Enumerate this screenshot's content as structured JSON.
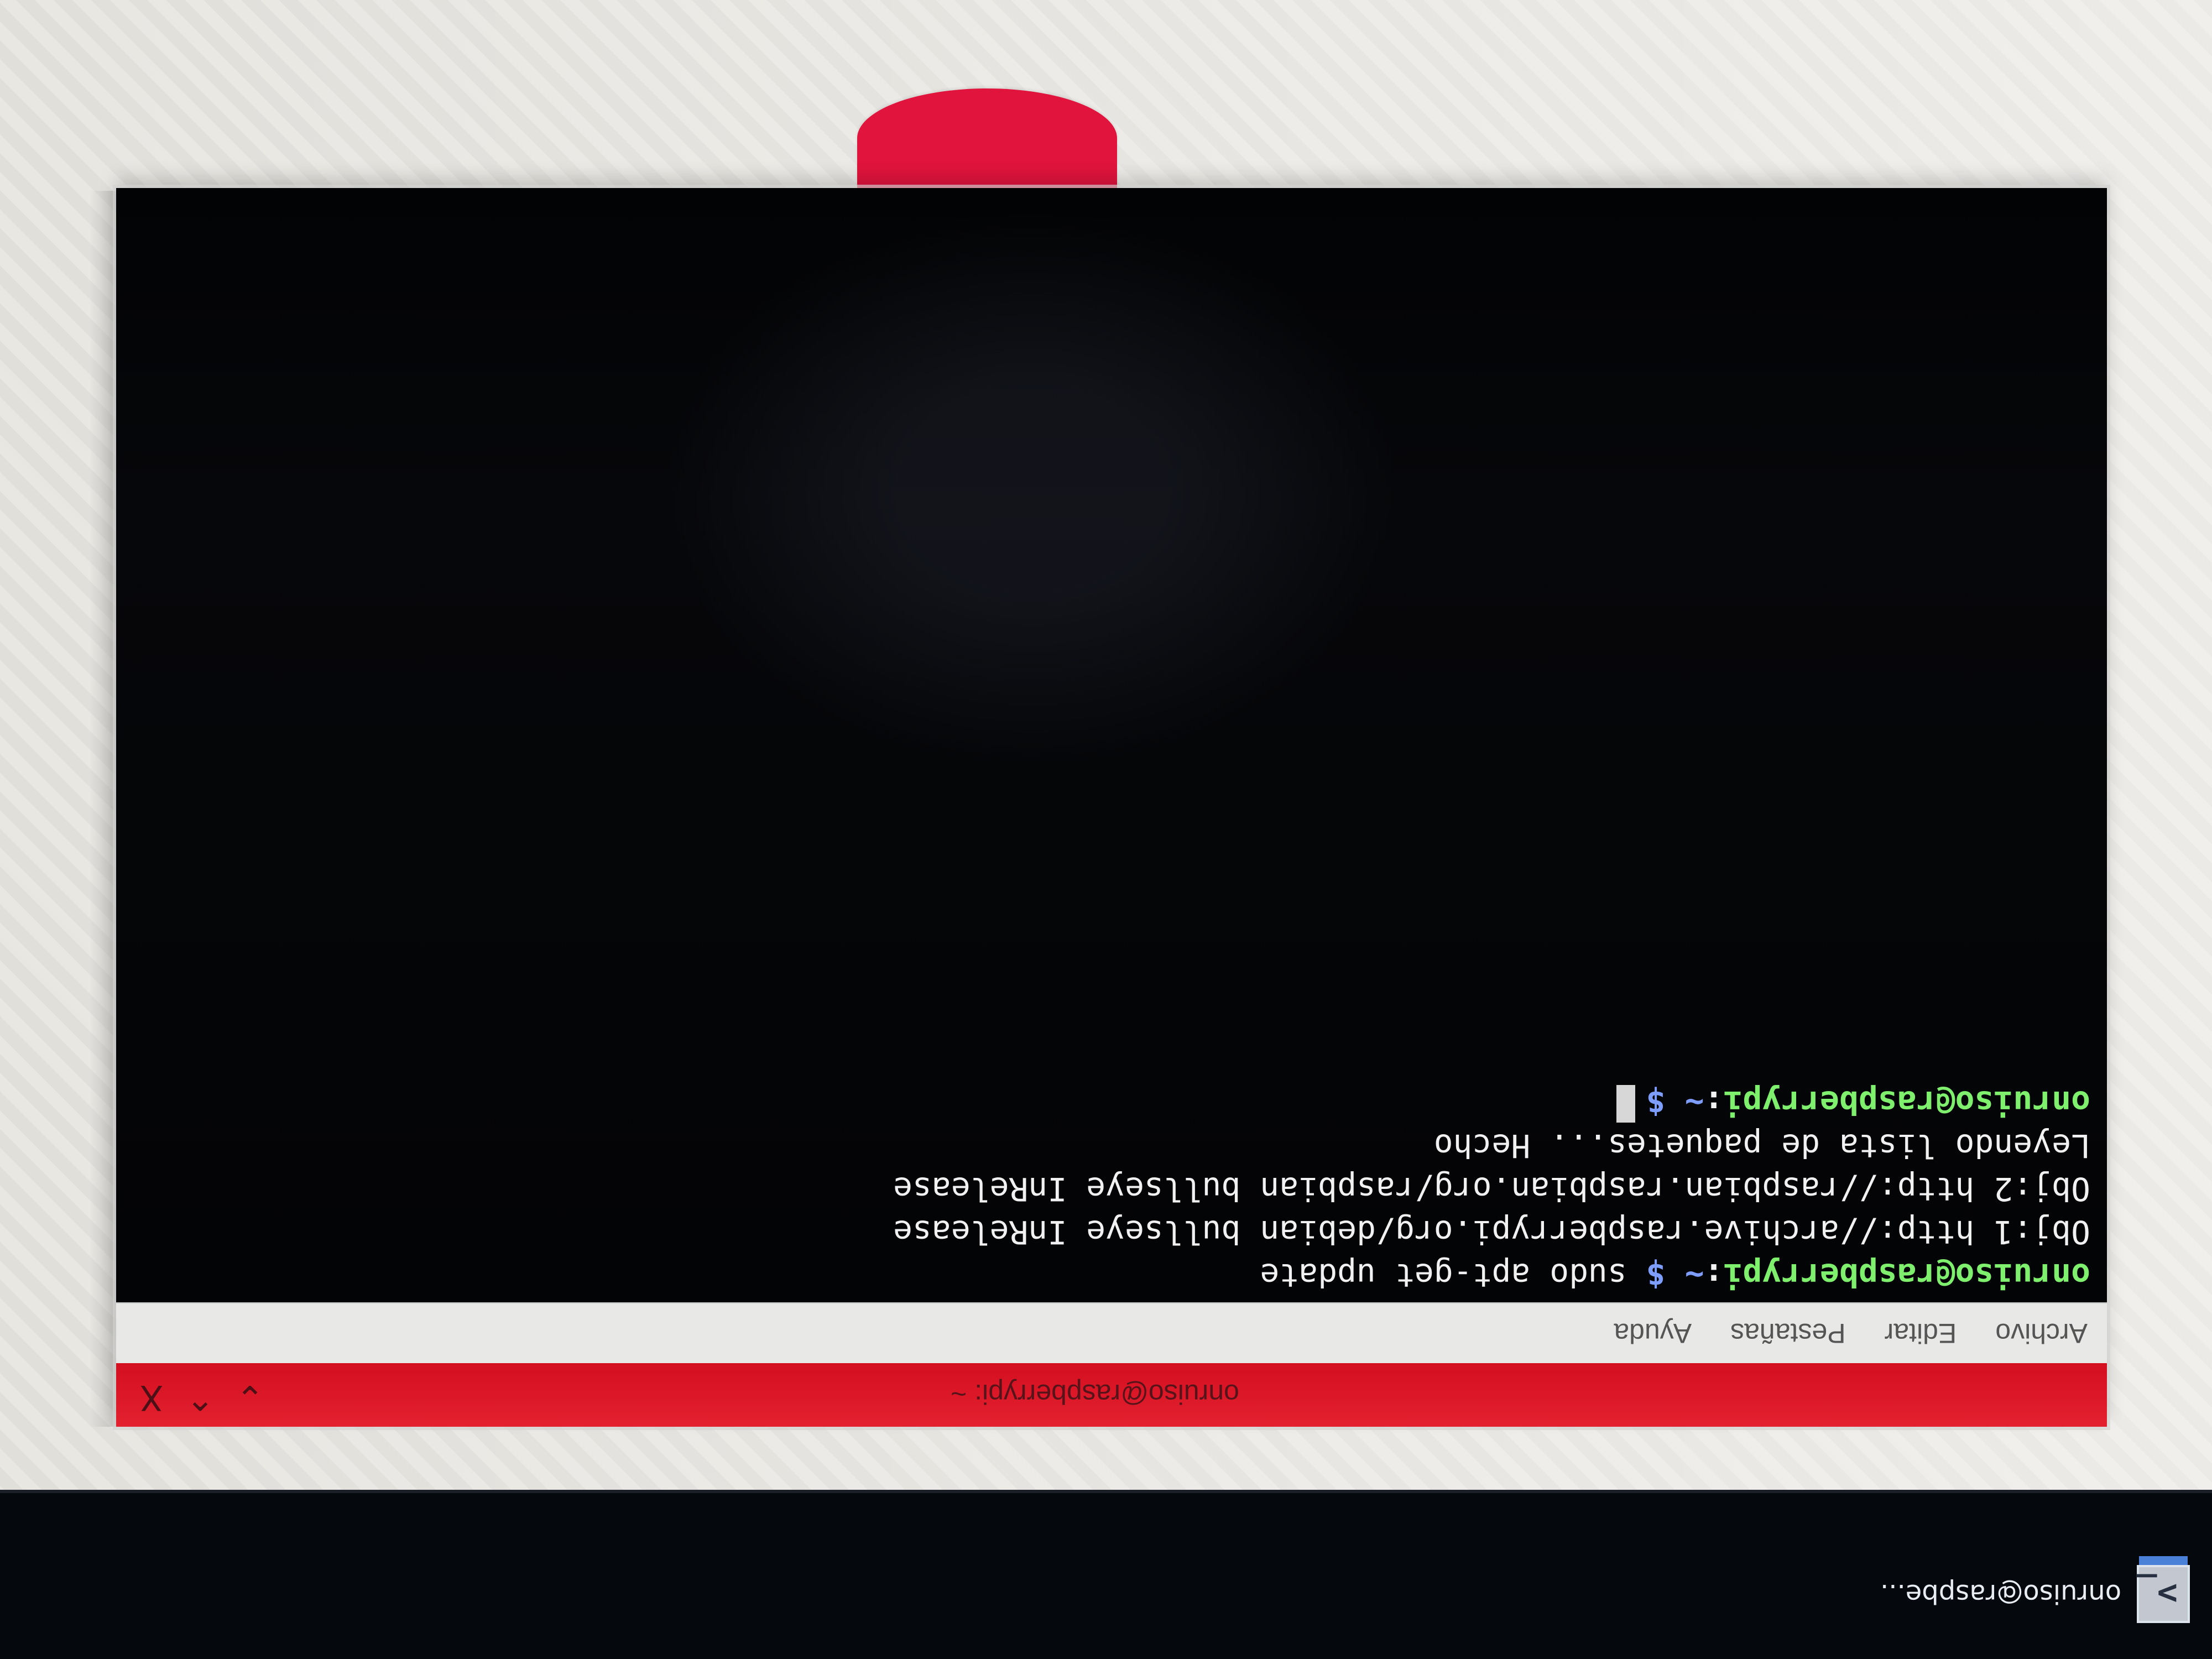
{
  "taskbar": {
    "app_label": "onruiso@raspbe...",
    "icon": "terminal-icon"
  },
  "window": {
    "title": "onruiso@raspberrypi: ~",
    "controls": {
      "minimize": "⌄",
      "maximize": "⌃",
      "close": "X"
    }
  },
  "menu": {
    "items": [
      "Archivo",
      "Editar",
      "Pestañas",
      "Ayuda"
    ]
  },
  "terminal": {
    "prompt_user": "onruiso@raspberrypi",
    "prompt_separator": ":",
    "prompt_path": "~",
    "prompt_symbol": "$",
    "command": "sudo apt-get update",
    "output": [
      "Obj:1 http://archive.raspberrypi.org/debian bullseye InRelease",
      "Obj:2 http://raspbian.raspbian.org/raspbian bullseye InRelease",
      "Leyendo lista de paquetes... Hecho"
    ]
  },
  "colors": {
    "titlebar": "#d40f20",
    "terminal_background": "#050608",
    "prompt_user": "#7ff06d",
    "prompt_path": "#7d9dff",
    "desktop_accent": "#e0143d"
  }
}
